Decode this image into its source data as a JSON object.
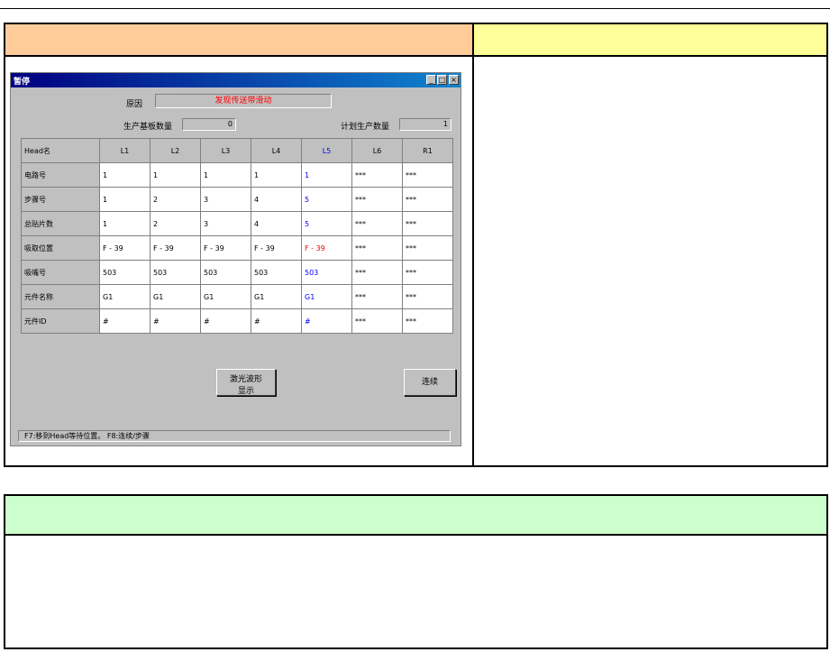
{
  "window": {
    "title": "暂停",
    "minimize": "_",
    "maximize": "□",
    "close": "×",
    "reason_label": "原因",
    "reason_value": "发现传送带滑动",
    "produced_label": "生产基板数量",
    "produced_value": "0",
    "planned_label": "计划生产数量",
    "planned_value": "1",
    "table": {
      "corner": "Head名",
      "columns": [
        "L1",
        "L2",
        "L3",
        "L4",
        "L5",
        "L6",
        "R1"
      ],
      "rows": [
        {
          "label": "电路号",
          "cells": [
            "1",
            "1",
            "1",
            "1",
            "1",
            "***",
            "***"
          ]
        },
        {
          "label": "步骤号",
          "cells": [
            "1",
            "2",
            "3",
            "4",
            "5",
            "***",
            "***"
          ]
        },
        {
          "label": "总贴片数",
          "cells": [
            "1",
            "2",
            "3",
            "4",
            "5",
            "***",
            "***"
          ]
        },
        {
          "label": "吸取位置",
          "cells": [
            "F - 39",
            "F - 39",
            "F - 39",
            "F - 39",
            "F - 39",
            "***",
            "***"
          ]
        },
        {
          "label": "吸嘴号",
          "cells": [
            "503",
            "503",
            "503",
            "503",
            "503",
            "***",
            "***"
          ]
        },
        {
          "label": "元件名称",
          "cells": [
            "G1",
            "G1",
            "G1",
            "G1",
            "G1",
            "***",
            "***"
          ]
        },
        {
          "label": "元件ID",
          "cells": [
            "#",
            "#",
            "#",
            "#",
            "#",
            "***",
            "***"
          ]
        }
      ]
    },
    "waveform_button_line1": "激光波形",
    "waveform_button_line2": "显示",
    "continue_button": "连续",
    "status": "F7:移到Head等待位置。 F8:连续/步骤"
  },
  "colors": {
    "header_left": "#ffcc99",
    "header_right": "#ffff99",
    "header_bottom": "#ccffcc",
    "highlight_column": "#0000ff",
    "alert": "#ff0000"
  }
}
